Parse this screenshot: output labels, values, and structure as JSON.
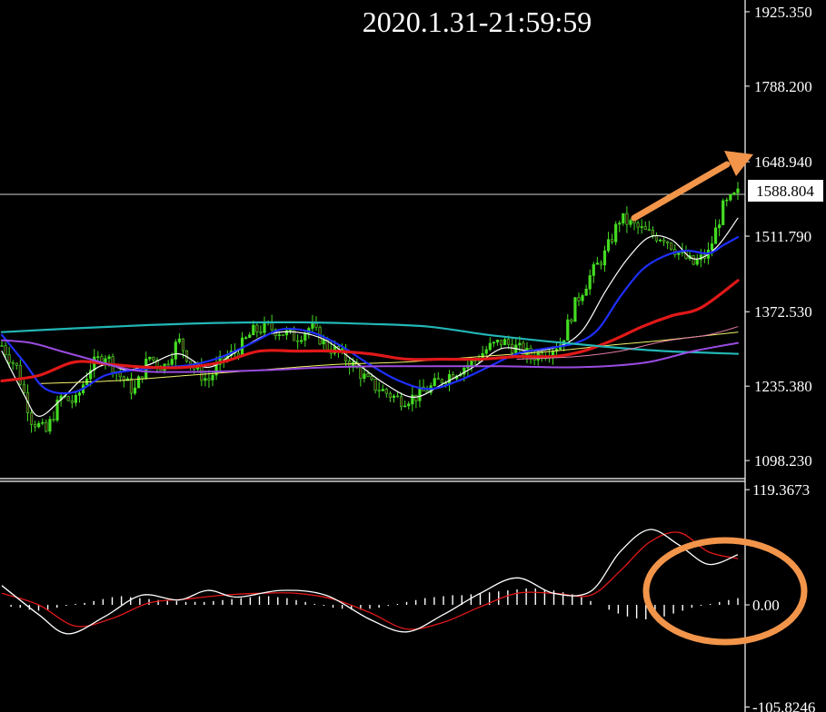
{
  "title": "2020.1.31-21:59:59",
  "colors": {
    "background": "#000000",
    "frame": "#ffffff",
    "candle": "#44dd22",
    "ma_white": "#ffffff",
    "ma_yellow": "#f3f36a",
    "ma_blue": "#1f2fff",
    "ma_red": "#e01818",
    "ma_cyan": "#22b6b6",
    "ma_purple": "#9a4be0",
    "ma_pink": "#e07aa6",
    "annotation": "#f2954a",
    "macd_line": "#ffffff",
    "signal_line": "#e01818"
  },
  "chart_data": [
    {
      "type": "candlestick",
      "panel": "price",
      "title": "2020.1.31-21:59:59",
      "y_ticks": [
        "1925.350",
        "1788.200",
        "1648.940",
        "1511.790",
        "1372.530",
        "1235.380",
        "1098.230"
      ],
      "y_tick_values": [
        1925.35,
        1788.2,
        1648.94,
        1511.79,
        1372.53,
        1235.38,
        1098.23
      ],
      "ylim": [
        1065,
        1947
      ],
      "current_price": "1588.804",
      "current_value": 1588.804,
      "close_path": [
        [
          0,
          1310
        ],
        [
          2,
          1270
        ],
        [
          4,
          1175
        ],
        [
          6,
          1150
        ],
        [
          8,
          1215
        ],
        [
          10,
          1205
        ],
        [
          12,
          1270
        ],
        [
          14,
          1295
        ],
        [
          16,
          1255
        ],
        [
          18,
          1225
        ],
        [
          20,
          1290
        ],
        [
          22,
          1270
        ],
        [
          24,
          1320
        ],
        [
          26,
          1270
        ],
        [
          28,
          1245
        ],
        [
          30,
          1285
        ],
        [
          32,
          1300
        ],
        [
          34,
          1335
        ],
        [
          36,
          1345
        ],
        [
          38,
          1335
        ],
        [
          40,
          1325
        ],
        [
          42,
          1345
        ],
        [
          44,
          1310
        ],
        [
          46,
          1295
        ],
        [
          48,
          1270
        ],
        [
          50,
          1240
        ],
        [
          52,
          1225
        ],
        [
          54,
          1210
        ],
        [
          56,
          1215
        ],
        [
          58,
          1230
        ],
        [
          60,
          1250
        ],
        [
          62,
          1265
        ],
        [
          64,
          1280
        ],
        [
          66,
          1305
        ],
        [
          68,
          1318
        ],
        [
          70,
          1305
        ],
        [
          72,
          1290
        ],
        [
          74,
          1300
        ],
        [
          76,
          1315
        ],
        [
          78,
          1390
        ],
        [
          80,
          1440
        ],
        [
          82,
          1480
        ],
        [
          84,
          1545
        ],
        [
          86,
          1530
        ],
        [
          88,
          1515
        ],
        [
          90,
          1510
        ],
        [
          92,
          1480
        ],
        [
          94,
          1460
        ],
        [
          96,
          1480
        ],
        [
          98,
          1565
        ],
        [
          100,
          1590
        ]
      ],
      "moving_averages": [
        {
          "color": "ma_white",
          "width": 1.2,
          "points": [
            [
              0,
              1300
            ],
            [
              3,
              1220
            ],
            [
              5,
              1180
            ],
            [
              8,
              1210
            ],
            [
              11,
              1250
            ],
            [
              14,
              1275
            ],
            [
              17,
              1265
            ],
            [
              20,
              1275
            ],
            [
              24,
              1295
            ],
            [
              28,
              1270
            ],
            [
              32,
              1300
            ],
            [
              36,
              1330
            ],
            [
              40,
              1335
            ],
            [
              44,
              1320
            ],
            [
              48,
              1280
            ],
            [
              52,
              1240
            ],
            [
              56,
              1215
            ],
            [
              60,
              1240
            ],
            [
              64,
              1270
            ],
            [
              68,
              1305
            ],
            [
              72,
              1300
            ],
            [
              76,
              1310
            ],
            [
              79,
              1340
            ],
            [
              82,
              1410
            ],
            [
              85,
              1470
            ],
            [
              88,
              1510
            ],
            [
              91,
              1505
            ],
            [
              94,
              1470
            ],
            [
              97,
              1490
            ],
            [
              100,
              1545
            ]
          ]
        },
        {
          "color": "ma_yellow",
          "width": 1.0,
          "points": [
            [
              5,
              1240
            ],
            [
              15,
              1245
            ],
            [
              25,
              1255
            ],
            [
              35,
              1265
            ],
            [
              45,
              1275
            ],
            [
              55,
              1280
            ],
            [
              65,
              1290
            ],
            [
              75,
              1300
            ],
            [
              82,
              1310
            ],
            [
              90,
              1320
            ],
            [
              100,
              1335
            ]
          ]
        },
        {
          "color": "ma_blue",
          "width": 2.2,
          "points": [
            [
              0,
              1330
            ],
            [
              3,
              1280
            ],
            [
              6,
              1230
            ],
            [
              10,
              1225
            ],
            [
              14,
              1255
            ],
            [
              18,
              1265
            ],
            [
              22,
              1270
            ],
            [
              26,
              1275
            ],
            [
              30,
              1290
            ],
            [
              34,
              1315
            ],
            [
              38,
              1340
            ],
            [
              42,
              1335
            ],
            [
              46,
              1310
            ],
            [
              50,
              1275
            ],
            [
              54,
              1245
            ],
            [
              58,
              1230
            ],
            [
              62,
              1245
            ],
            [
              66,
              1270
            ],
            [
              70,
              1295
            ],
            [
              74,
              1305
            ],
            [
              78,
              1315
            ],
            [
              81,
              1340
            ],
            [
              84,
              1400
            ],
            [
              87,
              1450
            ],
            [
              90,
              1475
            ],
            [
              93,
              1485
            ],
            [
              96,
              1480
            ],
            [
              98,
              1495
            ],
            [
              100,
              1510
            ]
          ]
        },
        {
          "color": "ma_red",
          "width": 3.2,
          "points": [
            [
              0,
              1245
            ],
            [
              5,
              1255
            ],
            [
              10,
              1280
            ],
            [
              15,
              1275
            ],
            [
              20,
              1270
            ],
            [
              25,
              1270
            ],
            [
              30,
              1280
            ],
            [
              35,
              1300
            ],
            [
              40,
              1300
            ],
            [
              45,
              1300
            ],
            [
              50,
              1295
            ],
            [
              55,
              1285
            ],
            [
              60,
              1285
            ],
            [
              65,
              1285
            ],
            [
              70,
              1290
            ],
            [
              75,
              1290
            ],
            [
              79,
              1300
            ],
            [
              83,
              1320
            ],
            [
              87,
              1345
            ],
            [
              91,
              1365
            ],
            [
              95,
              1380
            ],
            [
              100,
              1430
            ]
          ]
        },
        {
          "color": "ma_cyan",
          "width": 2.2,
          "points": [
            [
              0,
              1335
            ],
            [
              10,
              1342
            ],
            [
              20,
              1348
            ],
            [
              30,
              1352
            ],
            [
              40,
              1353
            ],
            [
              50,
              1350
            ],
            [
              58,
              1345
            ],
            [
              66,
              1330
            ],
            [
              74,
              1318
            ],
            [
              82,
              1308
            ],
            [
              90,
              1300
            ],
            [
              100,
              1295
            ]
          ]
        },
        {
          "color": "ma_purple",
          "width": 2.0,
          "points": [
            [
              0,
              1320
            ],
            [
              4,
              1315
            ],
            [
              8,
              1300
            ],
            [
              12,
              1285
            ],
            [
              16,
              1270
            ],
            [
              20,
              1262
            ],
            [
              28,
              1262
            ],
            [
              36,
              1265
            ],
            [
              44,
              1270
            ],
            [
              52,
              1272
            ],
            [
              60,
              1272
            ],
            [
              68,
              1272
            ],
            [
              76,
              1270
            ],
            [
              82,
              1272
            ],
            [
              88,
              1280
            ],
            [
              94,
              1300
            ],
            [
              100,
              1315
            ]
          ]
        },
        {
          "color": "ma_pink",
          "width": 1.0,
          "points": [
            [
              70,
              1285
            ],
            [
              78,
              1290
            ],
            [
              84,
              1300
            ],
            [
              90,
              1318
            ],
            [
              96,
              1330
            ],
            [
              100,
              1345
            ]
          ]
        }
      ]
    },
    {
      "type": "histogram+line",
      "panel": "indicator",
      "y_ticks": [
        "119.3673",
        "0.00",
        "-105.8246"
      ],
      "y_tick_values": [
        119.3673,
        0,
        -105.8246
      ],
      "ylim": [
        -111,
        128
      ],
      "histogram": [
        0,
        -2,
        -3,
        -5,
        -6,
        -5,
        -3,
        -1,
        1,
        2,
        4,
        6,
        8,
        9,
        8,
        7,
        6,
        5,
        5,
        4,
        3,
        3,
        3,
        4,
        5,
        6,
        7,
        8,
        9,
        9,
        8,
        7,
        5,
        3,
        1,
        -1,
        -3,
        -4,
        -5,
        -5,
        -4,
        -3,
        -1,
        1,
        3,
        5,
        7,
        8,
        9,
        10,
        10,
        11,
        12,
        13,
        14,
        15,
        16,
        17,
        17,
        16,
        15,
        13,
        11,
        8,
        4,
        0,
        -5,
        -9,
        -12,
        -14,
        -15,
        -14,
        -12,
        -9,
        -6,
        -3,
        -1,
        1,
        3,
        5,
        7
      ],
      "macd_line": [
        [
          0,
          20
        ],
        [
          5,
          -10
        ],
        [
          9,
          -30
        ],
        [
          14,
          -12
        ],
        [
          19,
          10
        ],
        [
          24,
          5
        ],
        [
          28,
          15
        ],
        [
          32,
          8
        ],
        [
          38,
          15
        ],
        [
          44,
          10
        ],
        [
          50,
          -15
        ],
        [
          55,
          -28
        ],
        [
          60,
          -10
        ],
        [
          65,
          12
        ],
        [
          70,
          28
        ],
        [
          75,
          12
        ],
        [
          80,
          14
        ],
        [
          84,
          55
        ],
        [
          88,
          78
        ],
        [
          92,
          62
        ],
        [
          96,
          42
        ],
        [
          100,
          52
        ]
      ],
      "signal_line": [
        [
          0,
          12
        ],
        [
          5,
          0
        ],
        [
          10,
          -22
        ],
        [
          15,
          -14
        ],
        [
          20,
          2
        ],
        [
          25,
          6
        ],
        [
          30,
          10
        ],
        [
          35,
          12
        ],
        [
          40,
          12
        ],
        [
          45,
          6
        ],
        [
          50,
          -8
        ],
        [
          55,
          -25
        ],
        [
          60,
          -18
        ],
        [
          65,
          -2
        ],
        [
          70,
          12
        ],
        [
          75,
          12
        ],
        [
          80,
          10
        ],
        [
          84,
          35
        ],
        [
          88,
          65
        ],
        [
          92,
          75
        ],
        [
          96,
          55
        ],
        [
          100,
          48
        ]
      ]
    }
  ]
}
